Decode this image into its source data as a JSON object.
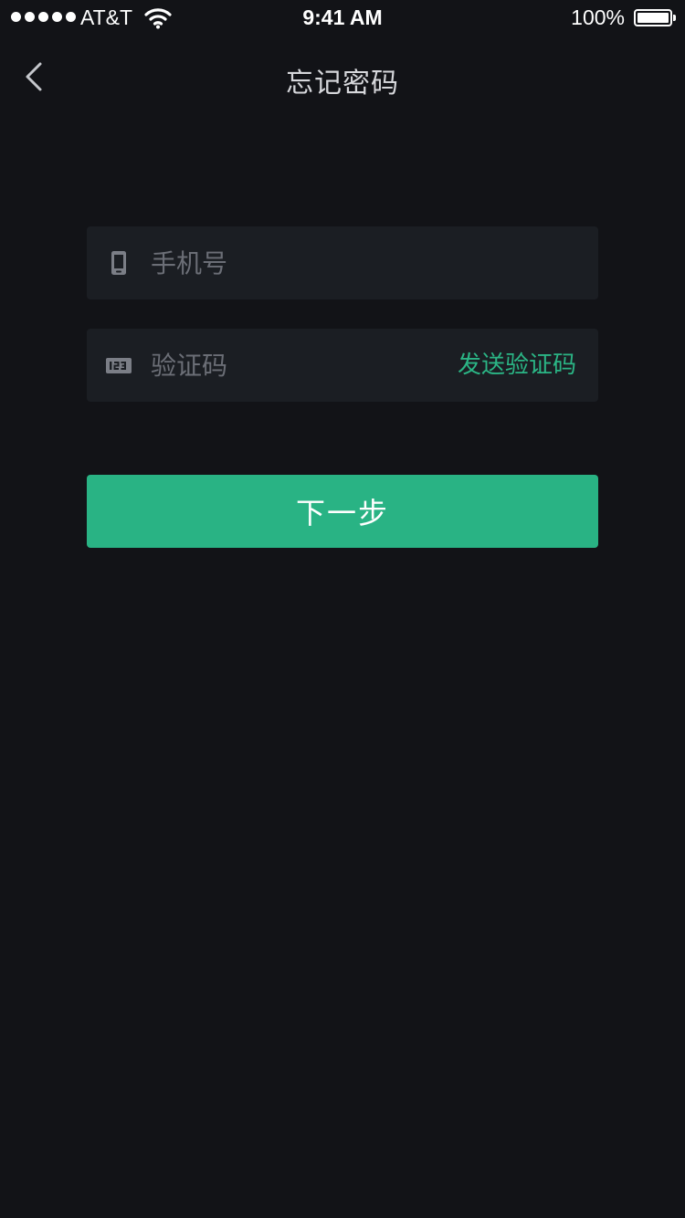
{
  "status_bar": {
    "carrier": "AT&T",
    "time": "9:41 AM",
    "battery": "100%",
    "battery_level": 1.0,
    "signal_bars": 5
  },
  "nav": {
    "back_icon": "chevron-left-icon",
    "title": "忘记密码"
  },
  "form": {
    "phone": {
      "icon": "phone-icon",
      "placeholder": "手机号",
      "value": ""
    },
    "code": {
      "icon": "numeric-keypad-icon",
      "placeholder": "验证码",
      "value": "",
      "send_label": "发送验证码"
    },
    "next_label": "下一步"
  },
  "colors": {
    "background": "#121317",
    "field_background": "#1b1e23",
    "accent": "#29b384",
    "placeholder": "#6b6e76"
  }
}
